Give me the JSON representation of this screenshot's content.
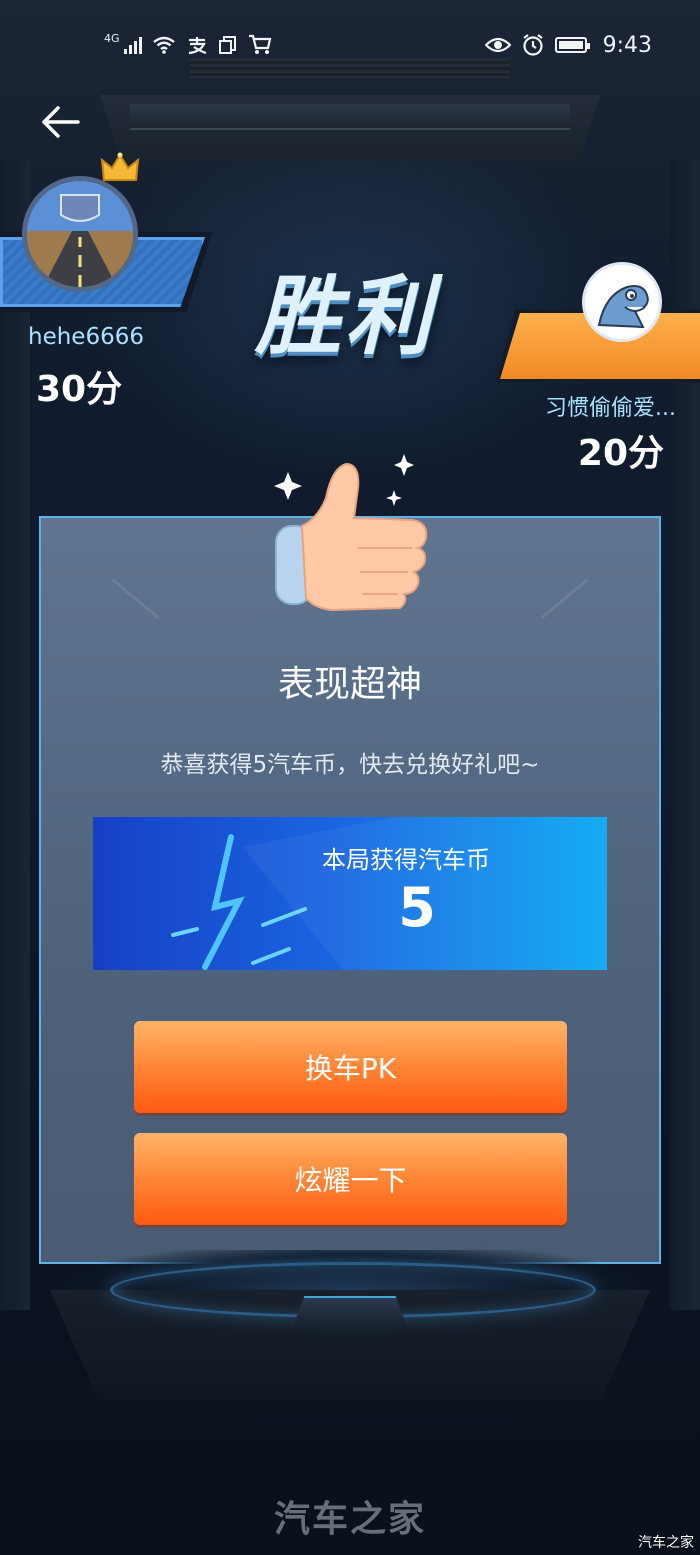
{
  "status_bar": {
    "network": "4G",
    "time": "9:43",
    "left_icons": [
      "signal-icon",
      "wifi-icon",
      "alipay-icon",
      "copy-icon",
      "cart-icon"
    ],
    "right_icons": [
      "eye-icon",
      "alarm-icon",
      "battery-icon"
    ]
  },
  "nav": {
    "back_icon": "arrow-left-icon"
  },
  "title": "胜利",
  "player_left": {
    "name": "hehe6666",
    "score": "30分",
    "badge_icon": "crown-icon",
    "plate_color": "#3b7bcc"
  },
  "player_right": {
    "name": "习惯偷偷爱...",
    "score": "20分",
    "plate_color": "#f59a30"
  },
  "result_card": {
    "icon": "thumbs-up-icon",
    "title": "表现超神",
    "subtitle": "恭喜获得5汽车币，快去兑换好礼吧~",
    "coin_label": "本局获得汽车币",
    "coin_value": "5"
  },
  "buttons": {
    "switch_car_pk": "换车PK",
    "show_off": "炫耀一下"
  },
  "watermark": {
    "large": "汽车之家",
    "small": "汽车之家"
  },
  "colors": {
    "accent_orange": "#ff7a2a",
    "card_border": "#5fb1ea",
    "banner_blue": "#1a63e0"
  }
}
